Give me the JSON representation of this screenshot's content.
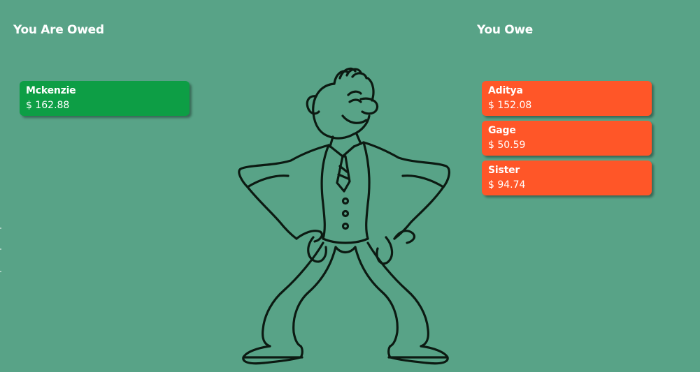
{
  "owed": {
    "title": "You Are Owed",
    "items": [
      {
        "name": "Mckenzie",
        "amount": "$ 162.88"
      }
    ]
  },
  "owe": {
    "title": "You Owe",
    "items": [
      {
        "name": "Aditya",
        "amount": "$ 152.08"
      },
      {
        "name": "Gage",
        "amount": "$ 50.59"
      },
      {
        "name": "Sister",
        "amount": "$ 94.74"
      }
    ]
  },
  "colors": {
    "background": "#58a387",
    "owed_card": "#0d9e45",
    "owe_card": "#ff5628",
    "text": "#ffffff",
    "illustration_stroke": "#0c1a12"
  },
  "illustration": {
    "name": "broke-man-empty-pockets-illustration"
  }
}
